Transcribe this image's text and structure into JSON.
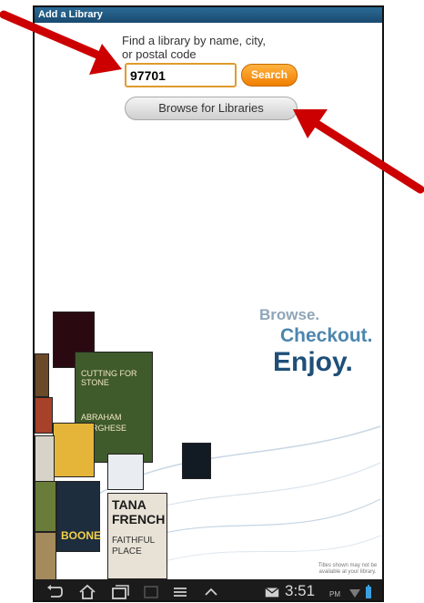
{
  "window": {
    "title": "Add a Library"
  },
  "search": {
    "prompt_line1": "Find a library by name, city,",
    "prompt_line2": "or postal code",
    "value": "97701",
    "button_label": "Search"
  },
  "browse": {
    "button_label": "Browse for Libraries"
  },
  "tagline": {
    "line1": "Browse.",
    "line2": "Checkout.",
    "line3": "Enjoy."
  },
  "disclaimer": "Titles shown may not be available at your library.",
  "book_covers": [
    {
      "title_lines": [
        "TANA",
        "FRENCH"
      ],
      "subtitle": "FAITHFUL PLACE"
    },
    {
      "title_lines": [
        "ABRAHAM",
        "VERGHESE"
      ],
      "subtitle": "CUTTING FOR STONE"
    },
    {
      "title_lines": [
        "BOONE"
      ],
      "subtitle": ""
    }
  ],
  "status_bar": {
    "time": "3:51",
    "ampm": "PM"
  },
  "colors": {
    "titlebar": "#1a4a6f",
    "search_button": "#f07e00",
    "input_border": "#e09b2d",
    "arrow": "#cc0000"
  },
  "icons": [
    "back-icon",
    "home-icon",
    "recent-apps-icon",
    "screenshot-icon",
    "menu-icon",
    "up-chevron-icon",
    "mail-icon",
    "wifi-icon",
    "battery-icon",
    "arrow-annotation"
  ]
}
